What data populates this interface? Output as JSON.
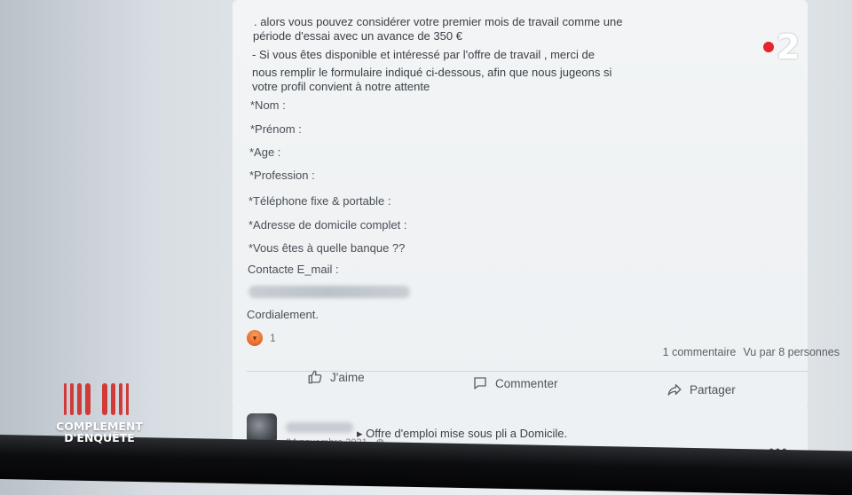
{
  "post": {
    "lines": [
      ". alors vous pouvez considérer votre premier mois de travail comme une",
      "période  d'essai avec un avance de 350 €",
      "- Si vous êtes disponible et intéressé par  l'offre de travail , merci de",
      "nous remplir le formulaire indiqué ci-dessous, afin que nous jugeons si",
      "votre profil convient à notre attente"
    ],
    "fields": [
      "*Nom :",
      "*Prénom :",
      "*Age :",
      "*Profession :",
      "*Téléphone fixe & portable :",
      "*Adresse de domicile complet :",
      "*Vous êtes à quelle banque ??",
      "Contacte E_mail :"
    ],
    "closing": "Cordialement.",
    "reaction_count": "1",
    "comments": "1 commentaire",
    "views": "Vu par 8 personnes"
  },
  "actions": {
    "like": "J'aime",
    "comment": "Commenter",
    "share": "Partager"
  },
  "next_post": {
    "title": "Offre d'emploi mise sous pli a Domicile.",
    "date": "24 novembre 2021 ·"
  },
  "overlay": {
    "channel": "2",
    "show_line1": "COMPLEMENT",
    "show_line2": "D'ENQUÊTE",
    "channel_color": "#e5242b",
    "show_bar_color": "#d23a3a"
  },
  "icons": {
    "reaction": "angry-emoji-icon",
    "like": "thumbs-up-icon",
    "comment": "speech-bubble-icon",
    "share": "share-arrow-icon",
    "privacy": "globe-icon",
    "more": "more-options-icon"
  }
}
